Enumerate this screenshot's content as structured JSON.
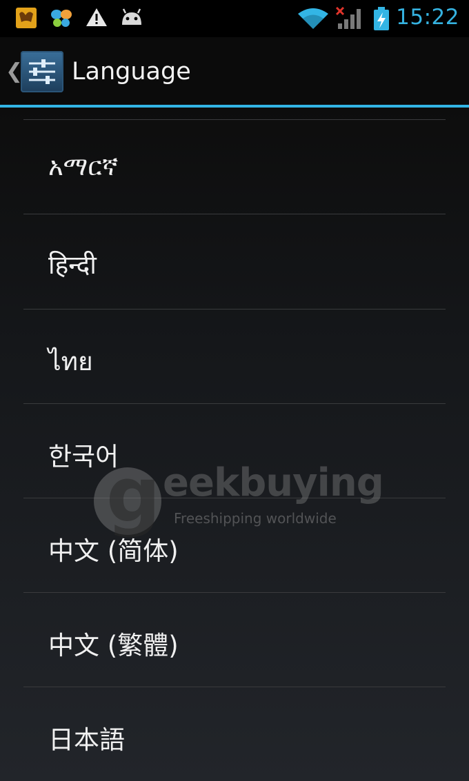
{
  "status_bar": {
    "time": "15:22",
    "icons": [
      "notification-app-icon",
      "butterfly-app-icon",
      "warning-icon",
      "android-debug-icon",
      "wifi-icon",
      "signal-no-service-icon",
      "battery-charging-icon"
    ],
    "accent_color": "#33b5e5"
  },
  "action_bar": {
    "title": "Language",
    "up_caret": "❮"
  },
  "languages": [
    "አማርኛ",
    "हिन्दी",
    "ไทย",
    "한국어",
    "中文 (简体)",
    "中文 (繁體)",
    "日本語"
  ],
  "watermark": {
    "brand": "eekbuying",
    "tagline": "Freeshipping worldwide"
  }
}
